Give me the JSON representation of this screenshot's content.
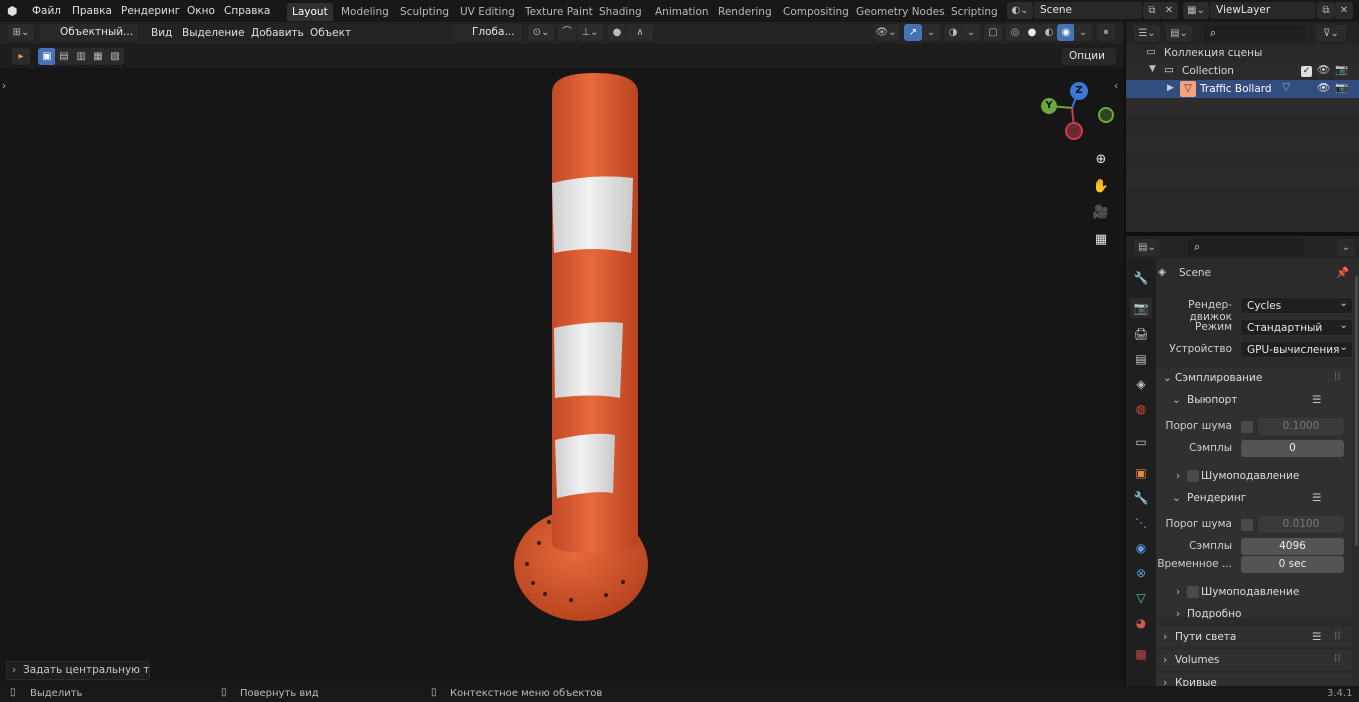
{
  "app": {
    "version": "3.4.1"
  },
  "menu": [
    "Файл",
    "Правка",
    "Рендеринг",
    "Окно",
    "Справка"
  ],
  "workspaces": [
    "Layout",
    "Modeling",
    "Sculpting",
    "UV Editing",
    "Texture Paint",
    "Shading",
    "Animation",
    "Rendering",
    "Compositing",
    "Geometry Nodes",
    "Scripting"
  ],
  "active_workspace": "Layout",
  "scene": {
    "name": "Scene"
  },
  "view_layer": {
    "name": "ViewLayer"
  },
  "viewport": {
    "mode": "Объектный...",
    "menu": [
      "Вид",
      "Выделение",
      "Добавить",
      "Объект"
    ],
    "transform_orientation": "Глоба...",
    "options_label": "Опции",
    "last_op": "Задать центральную точк",
    "gizmo": {
      "z": "Z",
      "y": "Y"
    }
  },
  "outliner": {
    "root": "Коллекция сцены",
    "collection": "Collection",
    "object": "Traffic Bollard"
  },
  "properties": {
    "scene_name": "Scene",
    "render_engine_label": "Рендер-движок",
    "render_engine": "Cycles",
    "mode_label": "Режим",
    "mode": "Стандартный",
    "device_label": "Устройство",
    "device": "GPU-вычисления",
    "sampling": "Сэмплирование",
    "viewport": "Выюпорт",
    "noise_threshold_label": "Порог шума",
    "viewport_threshold": "0.1000",
    "samples_label": "Сэмплы",
    "viewport_samples": "0",
    "denoise": "Шумоподавление",
    "render": "Рендеринг",
    "render_threshold": "0.0100",
    "render_samples": "4096",
    "time_limit_label": "Временное ...",
    "time_limit": "0 sec",
    "advanced": "Подробно",
    "light_paths": "Пути света",
    "volumes": "Volumes",
    "curves": "Кривые"
  },
  "status": {
    "select": "Выделить",
    "rotate": "Повернуть вид",
    "context": "Контекстное меню объектов"
  },
  "colors": {
    "accent": "#4772b3",
    "bollard_orange": "#e2653b",
    "bollard_white": "#e9e9e9"
  }
}
